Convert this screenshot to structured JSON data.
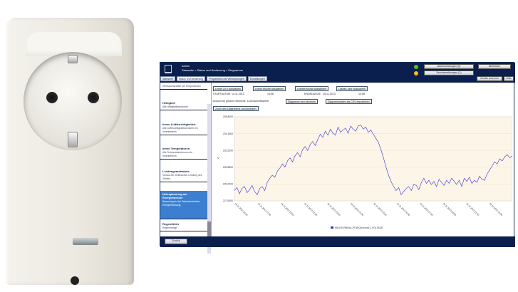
{
  "app": {
    "user": "Admin",
    "breadcrumb": "Startseite > Status und Bedienung > Diagramme",
    "tabs": [
      "Startseite",
      "Status und Bedienung",
      "Programme und Verknüpfungen",
      "Einstellungen"
    ],
    "alarm_label": "Alarmmeldungen (0)",
    "service_label": "Servicemeldungen (1)",
    "logout_label": "Abmelden",
    "help_label": "Hilfe",
    "wizard_label": "Geräte anlernen",
    "back_label": "Zurück",
    "colors": {
      "header": "#0a1f4d",
      "accent": "#3c7fd0",
      "alarm_dot": "#55c030",
      "service_dot": "#f0c020"
    }
  },
  "sidebar": {
    "top_label": "Verbrauchszähler bei Temperaturen",
    "items": [
      {
        "title": "Helligkeit",
        "desc": "Alle Helligkeitssensoren"
      },
      {
        "title": "Innen Luftfeuchtigkeiten",
        "desc": "Alle Luftfeuchtigkeitssensoren im Innenbereich"
      },
      {
        "title": "Innen Temperaturen",
        "desc": "Alle Temperatursensoren im Innenbereich"
      },
      {
        "title": "Leistungsaufnahme",
        "desc": "Verlauf der elektrischen Leistung des Zählers"
      },
      {
        "title": "Netzspannung am Energiemesser",
        "desc": "Spannung an der Zwischenstecker-Energiemessung"
      },
      {
        "title": "Regenfühler",
        "desc": "Regenmenge"
      }
    ]
  },
  "controls": {
    "last24": "Letzte 24 h auswählen",
    "lastweek": "Letzte Woche auswählen",
    "lastmonth": "Letzten Monat auswählen",
    "lastyear": "Letztes Jahr auswählen",
    "start_label": "STARTDATUM",
    "start_date": "14.11.2013",
    "start_time": "14:56",
    "end_label": "ENDEDATUM",
    "end_date": "15.11.2013",
    "end_time": "14:56",
    "size_label": "Ansicht für größere Bereiche",
    "size_value": "Durchschnittswerte",
    "draw": "Diagramm neu zeichnen",
    "export": "Diagrammdaten als CSV exportieren",
    "zoom": "Zoom des Diagramms zurücksetzen"
  },
  "chart_data": {
    "type": "line",
    "ylabel": "V",
    "ylim": [
      227.6,
      235.8
    ],
    "yticks": [
      "227,6000",
      "229,2400",
      "230,8800",
      "232,5200",
      "234,1600",
      "235,8000"
    ],
    "xticks": [
      "14.11.2013 15:00",
      "14.11.2013 17:00",
      "14.11.2013 19:00",
      "14.11.2013 21:00",
      "14.11.2013 23:00",
      "15.11.2013 01:00",
      "15.11.2013 03:00",
      "15.11.2013 05:00",
      "15.11.2013 07:00",
      "15.11.2013 09:00",
      "15.11.2013 11:00",
      "15.11.2013 13:00",
      "15.11.2013 14:56"
    ],
    "legend": "HM-ES-PMSw1-Pl NEQ0xxxxxx:2.VOLTAGE",
    "series": [
      {
        "color": "#3333cc",
        "values": [
          228.6,
          228.9,
          228.3,
          228.8,
          229.0,
          228.4,
          228.7,
          229.1,
          228.5,
          228.2,
          228.8,
          229.0,
          228.6,
          229.4,
          229.8,
          230.1,
          229.9,
          230.5,
          230.8,
          231.2,
          230.9,
          231.5,
          231.8,
          231.4,
          232.0,
          232.3,
          231.9,
          232.6,
          232.9,
          232.5,
          233.1,
          233.4,
          233.0,
          233.6,
          234.1,
          233.8,
          234.4,
          234.0,
          234.6,
          234.2,
          234.0,
          234.8,
          234.3,
          234.5,
          234.7,
          234.2,
          234.9,
          234.6,
          234.4,
          234.9,
          235.0,
          234.6,
          234.8,
          234.3,
          234.5,
          234.1,
          233.7,
          233.3,
          232.6,
          231.8,
          230.9,
          230.1,
          229.5,
          229.0,
          228.6,
          228.9,
          228.2,
          228.5,
          228.8,
          229.0,
          228.6,
          229.2,
          229.1,
          228.7,
          229.4,
          229.8,
          229.3,
          229.6,
          229.2,
          229.5,
          229.0,
          229.7,
          229.4,
          229.1,
          229.6,
          229.3,
          229.8,
          229.5,
          229.2,
          229.6,
          229.0,
          229.8,
          229.5,
          229.9,
          229.3,
          229.6,
          229.4,
          230.0,
          229.7,
          229.6,
          230.2,
          230.6,
          231.0,
          231.4,
          231.2,
          231.7,
          231.5,
          231.9,
          232.1,
          231.8,
          232.0
        ]
      }
    ]
  }
}
